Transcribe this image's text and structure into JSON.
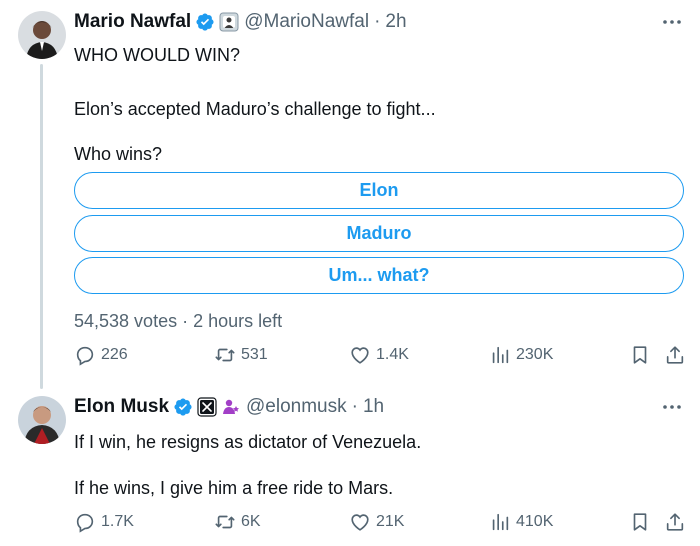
{
  "tweets": [
    {
      "name": "Mario Nawfal",
      "handle": "@MarioNawfal",
      "separator": "·",
      "time": "2h",
      "lines": [
        "WHO WOULD WIN?",
        "Elon’s accepted Maduro’s challenge to fight...",
        "Who wins?"
      ],
      "poll": {
        "options": [
          "Elon",
          "Maduro",
          "Um... what?"
        ],
        "votes": "54,538 votes",
        "dot": "·",
        "remaining": "2 hours left"
      },
      "stats": {
        "replies": "226",
        "retweets": "531",
        "likes": "1.4K",
        "views": "230K"
      }
    },
    {
      "name": "Elon Musk",
      "handle": "@elonmusk",
      "separator": "·",
      "time": "1h",
      "lines": [
        "If I win, he resigns as dictator of Venezuela.",
        "If he wins, I give him a free ride to Mars."
      ],
      "stats": {
        "replies": "1.7K",
        "retweets": "6K",
        "likes": "21K",
        "views": "410K"
      }
    }
  ],
  "colors": {
    "accent": "#1d9bf0",
    "text": "#0f1419",
    "muted": "#536471"
  },
  "icons": [
    "verified-badge-icon",
    "affiliate-badge-icon",
    "x-logo-icon",
    "subscriber-badge-icon",
    "more-icon",
    "reply-icon",
    "retweet-icon",
    "like-icon",
    "views-icon",
    "bookmark-icon",
    "share-icon"
  ]
}
